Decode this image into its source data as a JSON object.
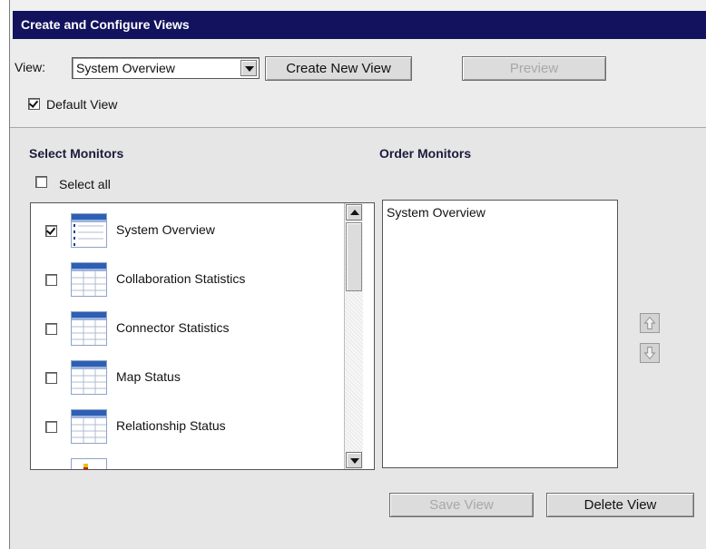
{
  "title": "Create and Configure Views",
  "view": {
    "label": "View:",
    "selected": "System Overview",
    "create_button": "Create New View",
    "preview_button": "Preview"
  },
  "default_view": {
    "label": "Default View",
    "checked": true
  },
  "select_monitors": {
    "heading": "Select Monitors",
    "select_all_label": "Select all",
    "items": [
      {
        "label": "System Overview",
        "checked": true,
        "icon": "list-view-icon"
      },
      {
        "label": "Collaboration Statistics",
        "checked": false,
        "icon": "table-icon"
      },
      {
        "label": "Connector Statistics",
        "checked": false,
        "icon": "table-icon"
      },
      {
        "label": "Map Status",
        "checked": false,
        "icon": "table-icon"
      },
      {
        "label": "Relationship Status",
        "checked": false,
        "icon": "table-icon"
      },
      {
        "label": "",
        "checked": false,
        "icon": "chart-icon"
      }
    ]
  },
  "order_monitors": {
    "heading": "Order Monitors",
    "items": [
      "System Overview"
    ]
  },
  "buttons": {
    "save_view": "Save View",
    "delete_view": "Delete View"
  },
  "colors": {
    "titlebar": "#12125e",
    "heading": "#1b1b3d",
    "disabled_text": "#a8a8a8"
  }
}
